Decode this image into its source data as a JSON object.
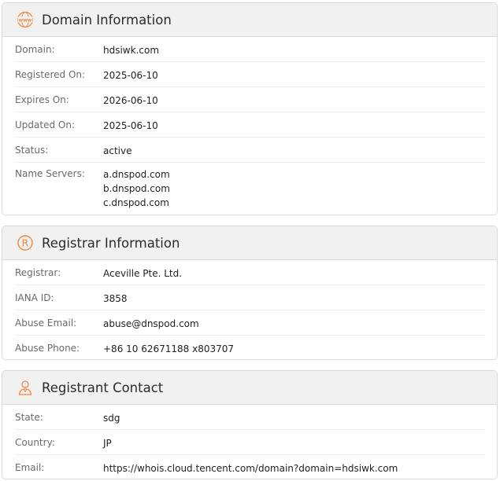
{
  "domain_info": {
    "title": "Domain Information",
    "icon": "www-globe-icon",
    "rows": [
      {
        "label": "Domain:",
        "value": "hdsiwk.com"
      },
      {
        "label": "Registered On:",
        "value": "2025-06-10"
      },
      {
        "label": "Expires On:",
        "value": "2026-06-10"
      },
      {
        "label": "Updated On:",
        "value": "2025-06-10"
      },
      {
        "label": "Status:",
        "value": "active"
      }
    ],
    "name_servers_label": "Name Servers:",
    "name_servers": [
      "a.dnspod.com",
      "b.dnspod.com",
      "c.dnspod.com"
    ]
  },
  "registrar_info": {
    "title": "Registrar Information",
    "icon": "registered-icon",
    "rows": [
      {
        "label": "Registrar:",
        "value": "Aceville Pte. Ltd."
      },
      {
        "label": "IANA ID:",
        "value": "3858"
      },
      {
        "label": "Abuse Email:",
        "value": "abuse@dnspod.com"
      },
      {
        "label": "Abuse Phone:",
        "value": "+86 10 62671188 x803707"
      }
    ]
  },
  "registrant_contact": {
    "title": "Registrant Contact",
    "icon": "person-icon",
    "rows": [
      {
        "label": "State:",
        "value": "sdg"
      },
      {
        "label": "Country:",
        "value": "JP"
      },
      {
        "label": "Email:",
        "value": "https://whois.cloud.tencent.com/domain?domain=hdsiwk.com"
      }
    ]
  },
  "colors": {
    "accent": "#f0883e",
    "header_bg": "#f1f1f1",
    "border": "#d9d9d9"
  }
}
